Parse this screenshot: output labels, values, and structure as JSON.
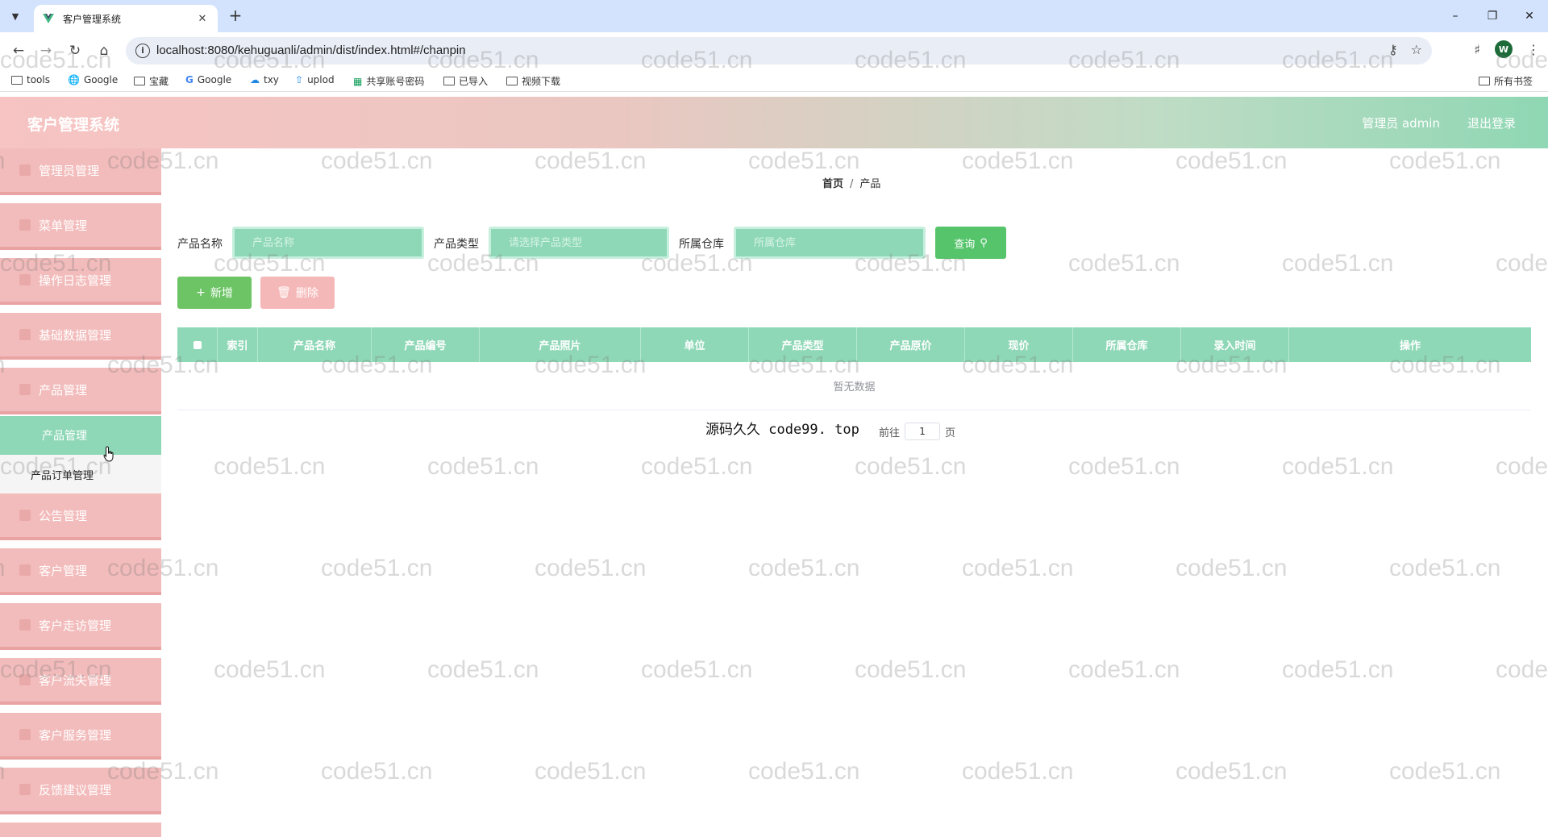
{
  "browser": {
    "tab_title": "客户管理系统",
    "url": "localhost:8080/kehuguanli/admin/dist/index.html#/chanpin",
    "profile_initial": "W",
    "bookmarks": [
      {
        "label": "tools",
        "icon": "folder-icon"
      },
      {
        "label": "Google",
        "icon": "globe-icon"
      },
      {
        "label": "宝藏",
        "icon": "folder-icon"
      },
      {
        "label": "Google",
        "icon": "google-icon"
      },
      {
        "label": "txy",
        "icon": "cloud-icon"
      },
      {
        "label": "uplod",
        "icon": "upload-icon"
      },
      {
        "label": "共享账号密码",
        "icon": "sheet-icon"
      },
      {
        "label": "已导入",
        "icon": "folder-icon"
      },
      {
        "label": "视频下载",
        "icon": "folder-icon"
      }
    ],
    "all_bookmarks": "所有书签"
  },
  "header": {
    "title": "客户管理系统",
    "user": "管理员 admin",
    "logout": "退出登录"
  },
  "sidebar": {
    "items": [
      {
        "label": "管理员管理"
      },
      {
        "label": "菜单管理"
      },
      {
        "label": "操作日志管理"
      },
      {
        "label": "基础数据管理"
      },
      {
        "label": "产品管理"
      },
      {
        "label": "公告管理"
      },
      {
        "label": "客户管理"
      },
      {
        "label": "客户走访管理"
      },
      {
        "label": "客户流失管理"
      },
      {
        "label": "客户服务管理"
      },
      {
        "label": "反馈建议管理"
      }
    ],
    "submenu": {
      "active": "产品管理",
      "other": "产品订单管理"
    }
  },
  "breadcrumb": {
    "home": "首页",
    "separator": "/",
    "current": "产品"
  },
  "search": {
    "name_label": "产品名称",
    "name_placeholder": "产品名称",
    "type_label": "产品类型",
    "type_placeholder": "请选择产品类型",
    "warehouse_label": "所属仓库",
    "warehouse_placeholder": "所属仓库",
    "button": "查询"
  },
  "actions": {
    "add": "新增",
    "delete": "删除"
  },
  "table": {
    "columns": [
      "索引",
      "产品名称",
      "产品编号",
      "产品照片",
      "单位",
      "产品类型",
      "产品原价",
      "现价",
      "所属仓库",
      "录入时间",
      "操作"
    ],
    "empty_text": "暂无数据"
  },
  "pager": {
    "goto_label": "前往",
    "page": "1",
    "page_suffix": "页"
  },
  "overlay_text": "源码久久 code99. top",
  "watermark": "code51.cn",
  "colors": {
    "header_start": "#f7c3c3",
    "header_end": "#8fd7b4",
    "sidebar_item": "#f3bcbc",
    "accent_green": "#8fd8b7",
    "search_button": "#55c46b",
    "add_button": "#6cc465",
    "delete_button": "#f5b8b8"
  }
}
